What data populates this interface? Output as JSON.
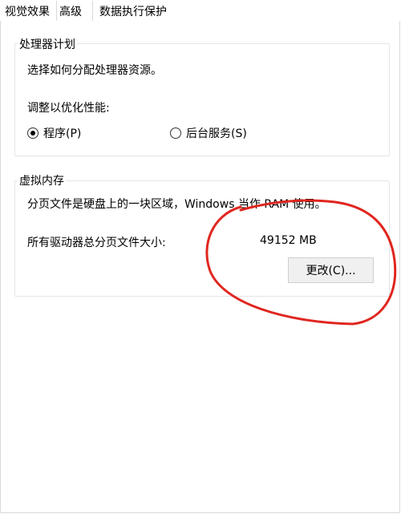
{
  "tabs": [
    {
      "label": "视觉效果"
    },
    {
      "label": "高级",
      "active": true
    },
    {
      "label": "数据执行保护"
    }
  ],
  "processor": {
    "title": "处理器计划",
    "description": "选择如何分配处理器资源。",
    "adjust_label": "调整以优化性能:",
    "options": [
      {
        "label": "程序(P)",
        "selected": true
      },
      {
        "label": "后台服务(S)",
        "selected": false
      }
    ]
  },
  "virtual_memory": {
    "title": "虚拟内存",
    "description": "分页文件是硬盘上的一块区域，Windows 当作 RAM 使用。",
    "total_label": "所有驱动器总分页文件大小:",
    "total_value": "49152 MB",
    "change_button": "更改(C)..."
  },
  "annotation": {
    "color": "#e0261f"
  }
}
